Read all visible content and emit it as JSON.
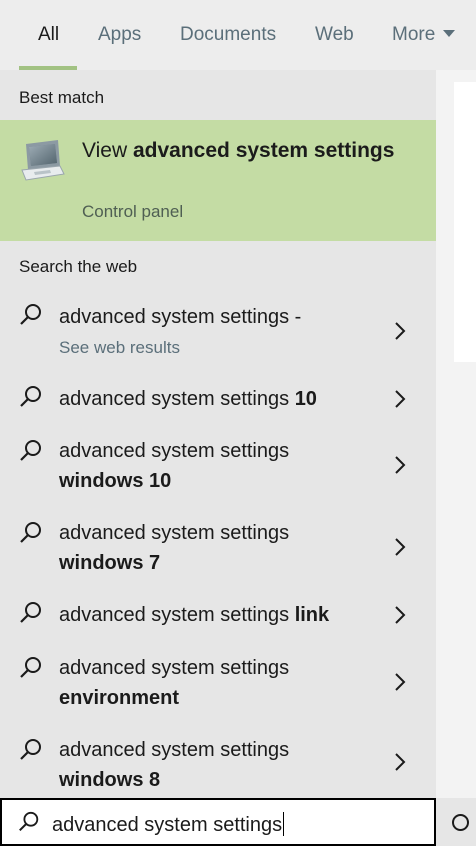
{
  "tabs": [
    {
      "label": "All",
      "active": true
    },
    {
      "label": "Apps"
    },
    {
      "label": "Documents"
    },
    {
      "label": "Web"
    },
    {
      "label": "More"
    }
  ],
  "best_match": {
    "section_label": "Best match",
    "title_prefix": "View ",
    "title_bold": "advanced system settings",
    "subtitle": "Control panel",
    "icon": "computer-monitor-icon"
  },
  "web": {
    "section_label": "Search the web",
    "items": [
      {
        "normal": "advanced system settings -",
        "bold": "",
        "sub": "See web results"
      },
      {
        "normal": "advanced system settings ",
        "bold": "10",
        "sub": ""
      },
      {
        "normal": "advanced system settings",
        "bold": "windows 10",
        "sub": ""
      },
      {
        "normal": "advanced system settings",
        "bold": "windows 7",
        "sub": ""
      },
      {
        "normal": "advanced system settings ",
        "bold": "link",
        "sub": ""
      },
      {
        "normal": "advanced system settings",
        "bold": "environment",
        "sub": ""
      },
      {
        "normal": "advanced system settings",
        "bold": "windows 8",
        "sub": ""
      }
    ]
  },
  "search": {
    "query": "advanced system settings"
  },
  "colors": {
    "highlight": "#c4dca4",
    "accent_underline": "#a2c283"
  }
}
